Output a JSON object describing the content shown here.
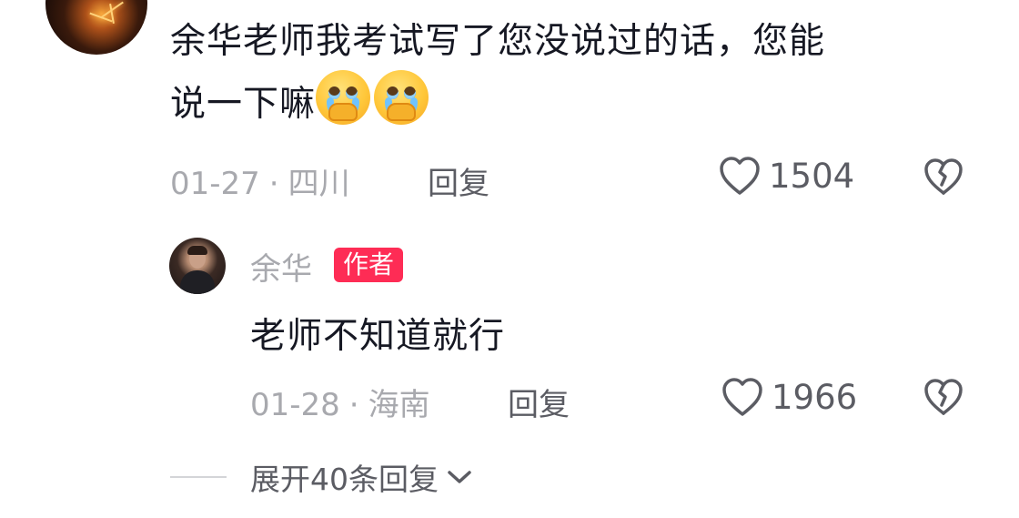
{
  "comment": {
    "text_line1": "余华老师我考试写了您没说过的话，您能",
    "text_line2": "说一下嘛",
    "emojis": [
      "crying-face-hands-emoji",
      "crying-face-hands-emoji"
    ],
    "date": "01-27",
    "separator": "·",
    "location": "四川",
    "reply_label": "回复",
    "like_count": "1504"
  },
  "reply": {
    "author": "余华",
    "badge": "作者",
    "text": "老师不知道就行",
    "date": "01-28",
    "separator": "·",
    "location": "海南",
    "reply_label": "回复",
    "like_count": "1966"
  },
  "expand": {
    "label": "展开40条回复"
  },
  "colors": {
    "badge": "#fe2c55",
    "primary_text": "#161823",
    "secondary_text": "#a8a9ae",
    "action_text": "#5b5c63"
  },
  "icons": [
    "heart-icon",
    "broken-heart-icon",
    "chevron-down-icon"
  ]
}
